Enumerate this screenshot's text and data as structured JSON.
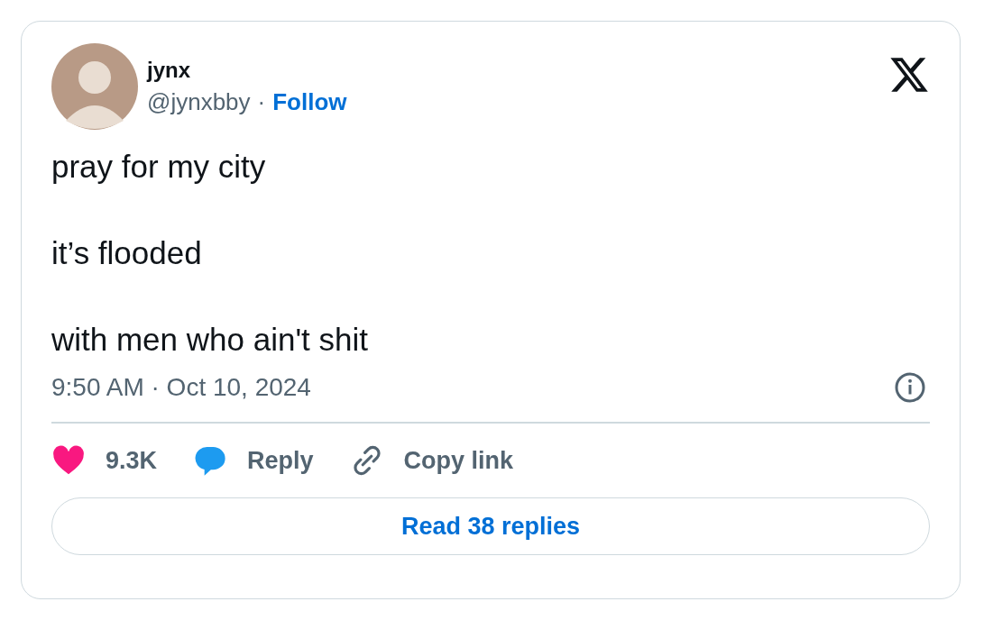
{
  "author": {
    "name": "jynx",
    "handle": "@jynxbby",
    "separator": "·",
    "follow": "Follow"
  },
  "body": [
    "pray for my city",
    "it’s flooded",
    "with men who ain't shit"
  ],
  "timestamp": "9:50 AM · Oct 10, 2024",
  "actions": [
    {
      "kind": "like",
      "label": "9.3K"
    },
    {
      "kind": "reply",
      "label": "Reply"
    },
    {
      "kind": "copy",
      "label": "Copy link"
    }
  ],
  "read_button": "Read 38 replies"
}
